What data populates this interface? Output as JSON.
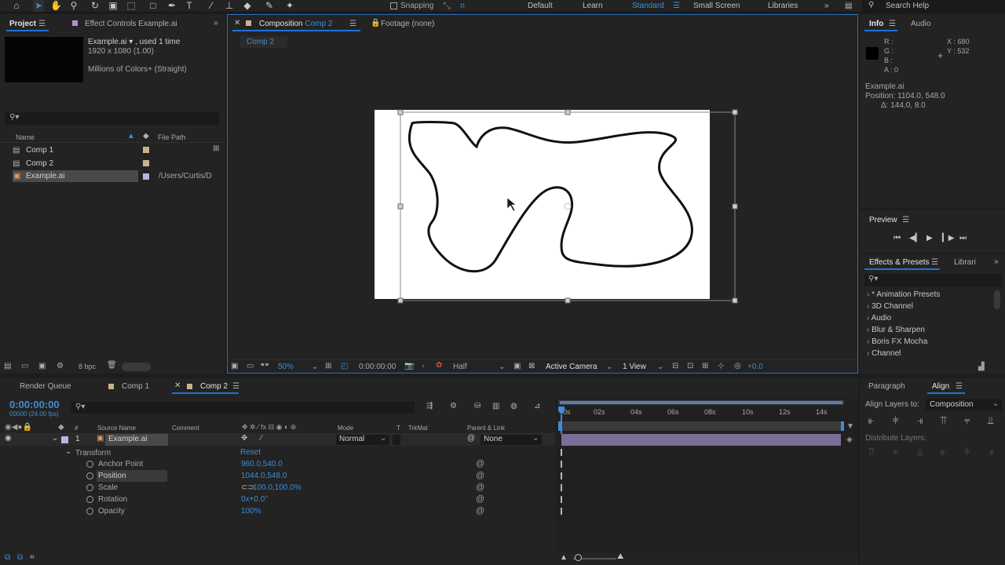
{
  "toolbar": {
    "snapping_label": "Snapping",
    "workspaces": [
      "Default",
      "Learn",
      "Standard",
      "Small Screen",
      "Libraries"
    ],
    "search_placeholder": "Search Help"
  },
  "project": {
    "tab_project": "Project",
    "tab_effect_controls": "Effect Controls Example.ai",
    "item_name": "Example.ai ▾ , used 1 time",
    "item_dims": "1920 x 1080 (1.00)",
    "item_colors": "Millions of Colors+ (Straight)",
    "col_name": "Name",
    "col_path": "File Path",
    "items": [
      {
        "name": "Comp 1",
        "path": ""
      },
      {
        "name": "Comp 2",
        "path": ""
      },
      {
        "name": "Example.ai",
        "path": "/Users/Curtis/D"
      }
    ],
    "bpc": "8 bpc"
  },
  "composition": {
    "tab_label": "Composition",
    "tab_comp": "Comp 2",
    "footage_label": "Footage (none)",
    "breadcrumb": "Comp 2",
    "zoom": "50%",
    "timecode": "0:00:00:00",
    "resolution": "Half",
    "camera": "Active Camera",
    "views": "1 View",
    "exposure": "+0.0"
  },
  "info": {
    "tab_info": "Info",
    "tab_audio": "Audio",
    "r_label": "R :",
    "g_label": "G :",
    "b_label": "B :",
    "a_label": "A :  0",
    "x_readout": "X : 680",
    "y_readout": "Y : 532",
    "layer_name": "Example.ai",
    "position_line": "Position: 1104.0, 548.0",
    "delta_line": "Δ: 144.0, 8.0"
  },
  "preview": {
    "title": "Preview"
  },
  "effects": {
    "tab_effects": "Effects & Presets",
    "tab_libraries": "Librari",
    "items": [
      "* Animation Presets",
      "3D Channel",
      "Audio",
      "Blur & Sharpen",
      "Boris FX Mocha",
      "Channel"
    ]
  },
  "timeline": {
    "tab_render": "Render Queue",
    "tab_comp1": "Comp 1",
    "tab_comp2": "Comp 2",
    "timecode": "0:00:00:00",
    "fps": "00000 (24.00 fps)",
    "col_num": "#",
    "col_source": "Source Name",
    "col_comment": "Comment",
    "col_mode": "Mode",
    "col_t": "T",
    "col_trkmat": "TrkMat",
    "col_parent": "Parent & Link",
    "layer_num": "1",
    "layer_name": "Example.ai",
    "layer_mode": "Normal",
    "layer_parent": "None",
    "transform_label": "Transform",
    "reset_label": "Reset",
    "properties": [
      {
        "name": "Anchor Point",
        "value": "960.0,540.0"
      },
      {
        "name": "Position",
        "value": "1044.0,548.0"
      },
      {
        "name": "Scale",
        "value": "100.0,100.0%"
      },
      {
        "name": "Rotation",
        "value": "0x+0.0°"
      },
      {
        "name": "Opacity",
        "value": "100%"
      }
    ],
    "ruler": [
      "0s",
      "02s",
      "04s",
      "06s",
      "08s",
      "10s",
      "12s",
      "14s"
    ]
  },
  "align": {
    "tab_paragraph": "Paragraph",
    "tab_align": "Align",
    "align_to_label": "Align Layers to:",
    "align_to_value": "Composition",
    "distribute_label": "Distribute Layers:"
  }
}
